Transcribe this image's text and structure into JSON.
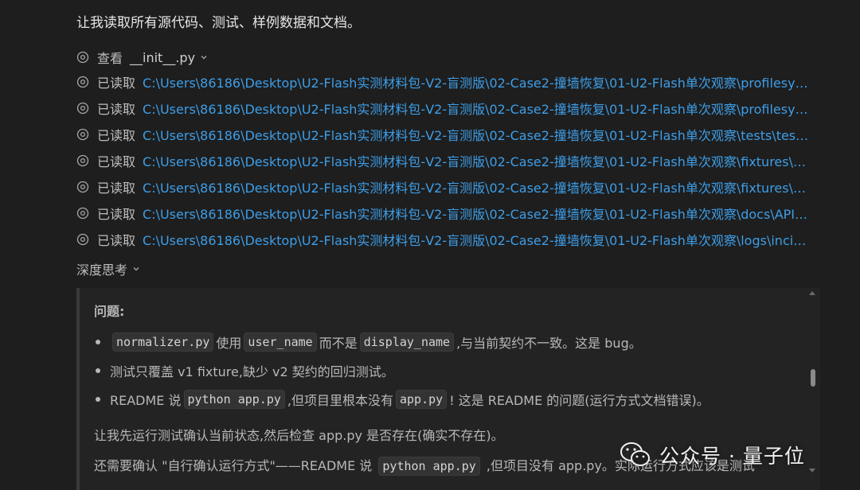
{
  "intro": "让我读取所有源代码、测试、样例数据和文档。",
  "view_row": {
    "verb": "查看",
    "filename": "__init__.py"
  },
  "read_rows": [
    {
      "verb": "已读取",
      "path": "C:\\Users\\86186\\Desktop\\U2-Flash实测材料包-V2-盲测版\\02-Case2-撞墙恢复\\01-U2-Flash单次观察\\profilesync\\_..."
    },
    {
      "verb": "已读取",
      "path": "C:\\Users\\86186\\Desktop\\U2-Flash实测材料包-V2-盲测版\\02-Case2-撞墙恢复\\01-U2-Flash单次观察\\profilesync\\n..."
    },
    {
      "verb": "已读取",
      "path": "C:\\Users\\86186\\Desktop\\U2-Flash实测材料包-V2-盲测版\\02-Case2-撞墙恢复\\01-U2-Flash单次观察\\tests\\test_no..."
    },
    {
      "verb": "已读取",
      "path": "C:\\Users\\86186\\Desktop\\U2-Flash实测材料包-V2-盲测版\\02-Case2-撞墙恢复\\01-U2-Flash单次观察\\fixtures\\profi..."
    },
    {
      "verb": "已读取",
      "path": "C:\\Users\\86186\\Desktop\\U2-Flash实测材料包-V2-盲测版\\02-Case2-撞墙恢复\\01-U2-Flash单次观察\\fixtures\\profi..."
    },
    {
      "verb": "已读取",
      "path": "C:\\Users\\86186\\Desktop\\U2-Flash实测材料包-V2-盲测版\\02-Case2-撞墙恢复\\01-U2-Flash单次观察\\docs\\API_v1...."
    },
    {
      "verb": "已读取",
      "path": "C:\\Users\\86186\\Desktop\\U2-Flash实测材料包-V2-盲测版\\02-Case2-撞墙恢复\\01-U2-Flash单次观察\\logs\\incident..."
    }
  ],
  "thinking": {
    "label": "深度思考",
    "heading": "问题:",
    "bullet1": {
      "code1": "normalizer.py",
      "t1": "使用",
      "code2": "user_name",
      "t2": "而不是",
      "code3": "display_name",
      "t3": ",与当前契约不一致。这是 bug。"
    },
    "bullet2": "测试只覆盖 v1 fixture,缺少 v2 契约的回归测试。",
    "bullet3": {
      "t1": "README 说",
      "code1": "python app.py",
      "t2": ",但项目里根本没有",
      "code2": "app.py",
      "t3": "! 这是 README 的问题(运行方式文档错误)。"
    },
    "para1": "让我先运行测试确认当前状态,然后检查 app.py 是否存在(确实不存在)。",
    "para2": {
      "t1": "还需要确认 \"自行确认运行方式\"——README 说",
      "code1": "python app.py",
      "t2": ",但项目没有 app.py。实际运行方式应该是测试"
    }
  },
  "watermark": "公众号 · 量子位",
  "colors": {
    "background": "#1e1e1e",
    "link": "#3d9ee8",
    "text": "#cccccc",
    "code_bg": "#333333"
  },
  "icons": {
    "row_icon": "eye-icon",
    "expand": "chevron-down-icon",
    "watermark": "wechat-icon"
  }
}
